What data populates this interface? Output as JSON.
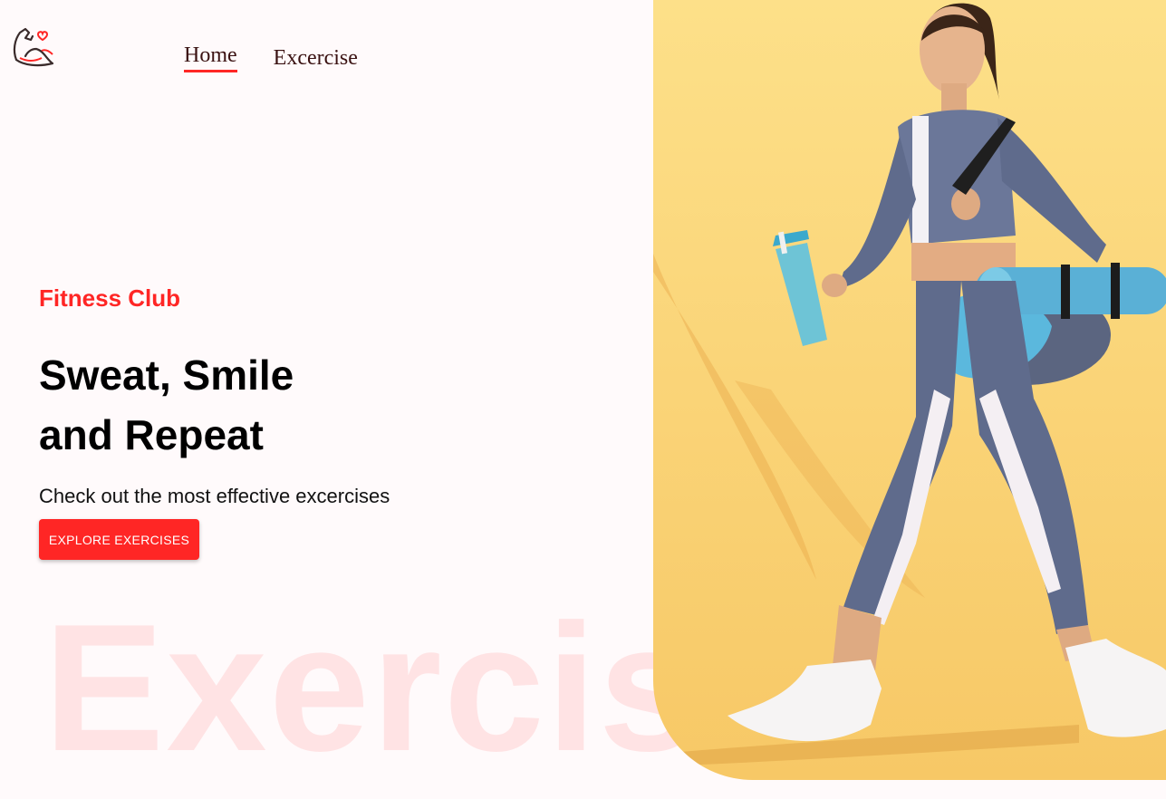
{
  "logo": {
    "icon": "flexed-arm-heart-icon",
    "accent": "#ff2625"
  },
  "nav": {
    "items": [
      {
        "label": "Home"
      },
      {
        "label": "Excercise"
      }
    ]
  },
  "hero": {
    "subtitle": "Fitness Club",
    "headline_line1": "Sweat, Smile",
    "headline_line2": "and Repeat",
    "description": "Check out the most effective excercises",
    "cta_label": "EXPLORE EXERCISES",
    "watermark": "Exercise",
    "image": "woman-walking-with-gym-bag-and-shaker-photo"
  },
  "colors": {
    "accent": "#ff2625",
    "background": "#fffafb",
    "image_background": "#fbd36a"
  }
}
